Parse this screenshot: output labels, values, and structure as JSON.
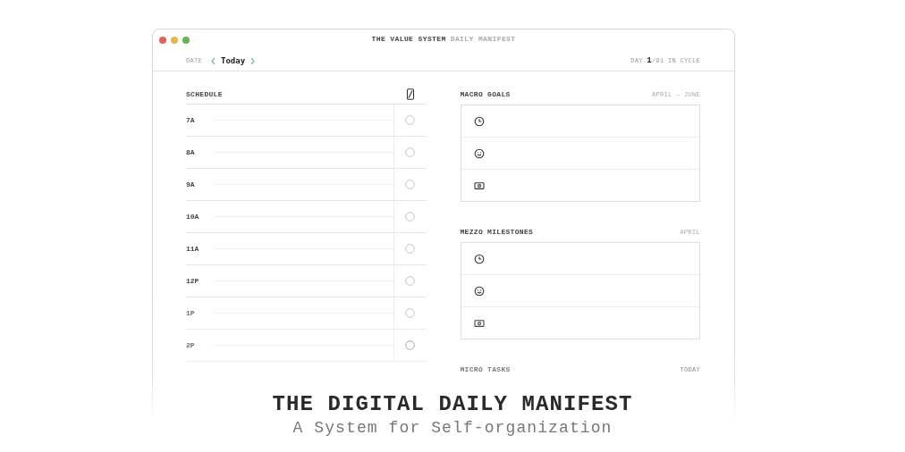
{
  "window": {
    "title": "THE VALUE SYSTEM",
    "title_suffix": "DAILY MANIFEST",
    "controls": [
      {
        "color": "#e0605a"
      },
      {
        "color": "#e6b84a"
      },
      {
        "color": "#62b654"
      }
    ]
  },
  "date_bar": {
    "label": "DATE",
    "value": "Today",
    "cycle": "DAY **1**/91 IN CYCLE"
  },
  "schedule": {
    "title": "SCHEDULE",
    "rows": [
      {
        "time": "7A",
        "checked": false
      },
      {
        "time": "8A",
        "checked": false
      },
      {
        "time": "9A",
        "checked": false
      },
      {
        "time": "10A",
        "checked": false
      },
      {
        "time": "11A",
        "checked": false
      },
      {
        "time": "12P",
        "checked": false
      },
      {
        "time": "1P",
        "checked": false
      },
      {
        "time": "2P",
        "checked": false
      }
    ]
  },
  "macro_goals": {
    "title": "MACRO GOALS",
    "range": "APRIL – JUNE",
    "rows": [
      {
        "kind": "clock"
      },
      {
        "kind": "smile"
      },
      {
        "kind": "money"
      }
    ]
  },
  "mezzo_milestones": {
    "title": "MEZZO MILESTONES",
    "range": "APRIL",
    "rows": [
      {
        "kind": "clock"
      },
      {
        "kind": "smile"
      },
      {
        "kind": "money"
      }
    ]
  },
  "micro_tasks": {
    "title": "MICRO TASKS",
    "range": "TODAY"
  },
  "overlay": {
    "title": "THE DIGITAL DAILY MANIFEST",
    "subtitle": "A System for Self-organization"
  }
}
